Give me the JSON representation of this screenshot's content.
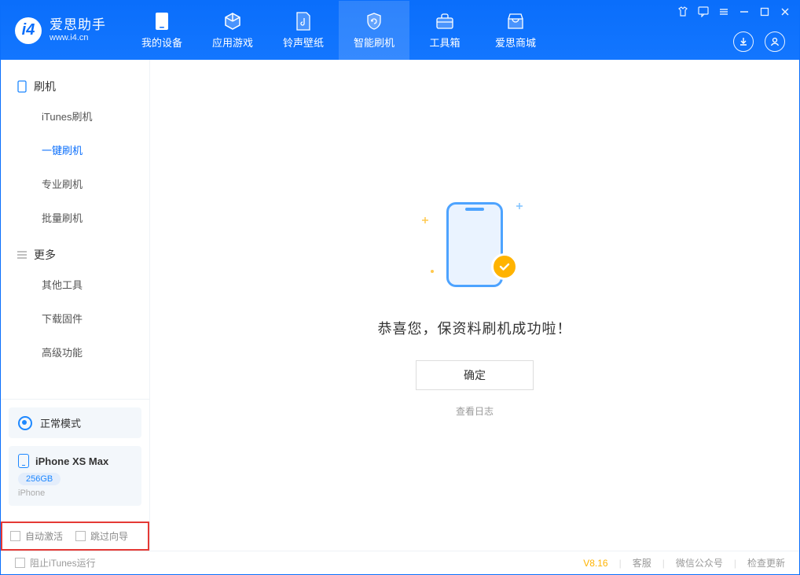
{
  "app": {
    "title": "爱思助手",
    "subtitle": "www.i4.cn"
  },
  "nav": {
    "tabs": [
      {
        "label": "我的设备"
      },
      {
        "label": "应用游戏"
      },
      {
        "label": "铃声壁纸"
      },
      {
        "label": "智能刷机"
      },
      {
        "label": "工具箱"
      },
      {
        "label": "爱思商城"
      }
    ]
  },
  "sidebar": {
    "section_flash": {
      "title": "刷机",
      "items": [
        "iTunes刷机",
        "一键刷机",
        "专业刷机",
        "批量刷机"
      ],
      "active_index": 1
    },
    "section_more": {
      "title": "更多",
      "items": [
        "其他工具",
        "下载固件",
        "高级功能"
      ]
    },
    "status_label": "正常模式",
    "device": {
      "name": "iPhone XS Max",
      "capacity": "256GB",
      "type": "iPhone"
    },
    "checkboxes": {
      "auto_activate": "自动激活",
      "skip_guide": "跳过向导"
    }
  },
  "main": {
    "success_text": "恭喜您，保资料刷机成功啦！",
    "ok_button": "确定",
    "log_link": "查看日志"
  },
  "footer": {
    "stop_itunes": "阻止iTunes运行",
    "version": "V8.16",
    "links": {
      "service": "客服",
      "wechat": "微信公众号",
      "update": "检查更新"
    }
  }
}
